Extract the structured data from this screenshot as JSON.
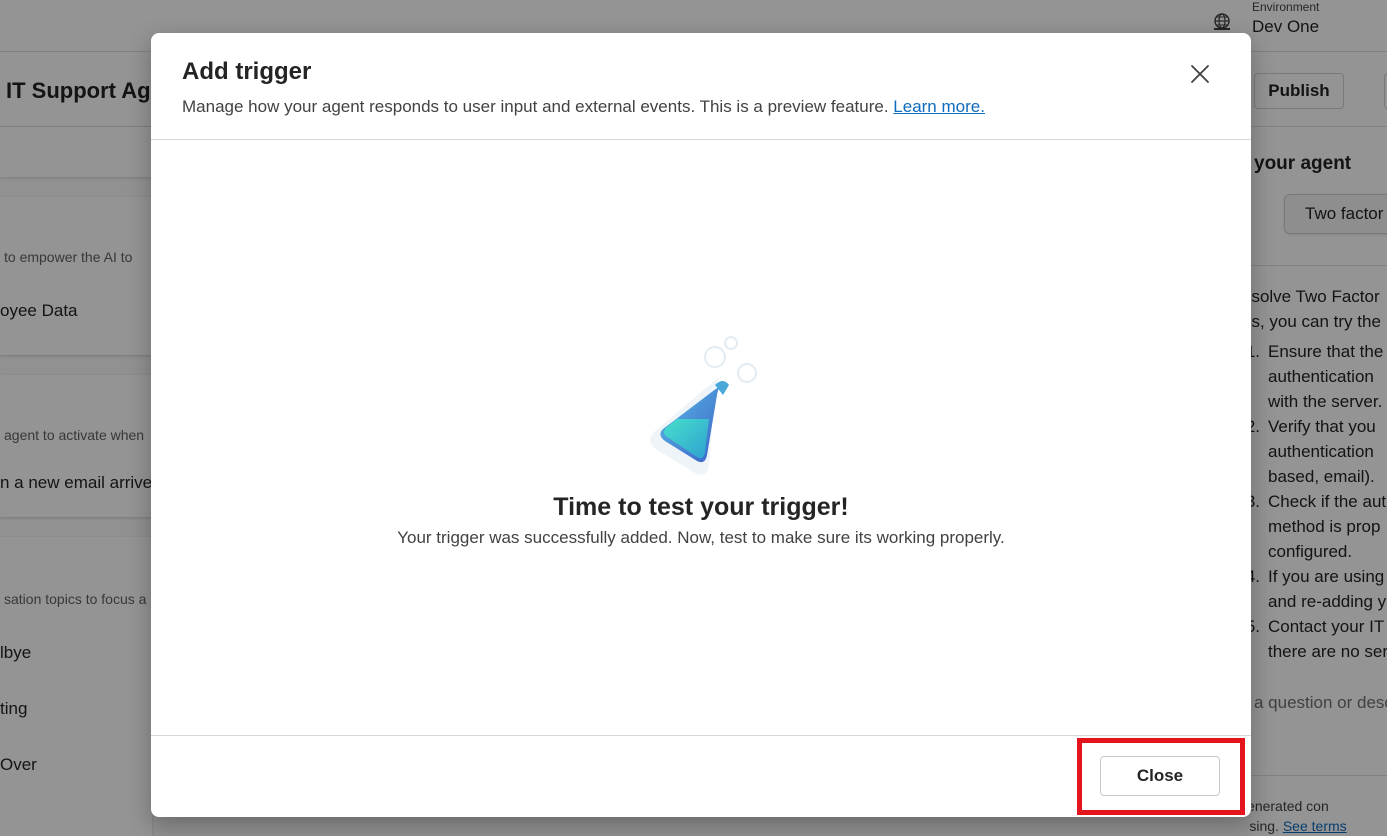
{
  "environment": {
    "label": "Environment",
    "value": "Dev One",
    "icon": "globe-icon"
  },
  "agent": {
    "title": "IT Support Agent"
  },
  "header": {
    "publish_label": "Publish"
  },
  "left_panel": {
    "knowledge": {
      "hint": "to empower the AI to",
      "item": "oyee Data"
    },
    "triggers": {
      "hint": "agent to activate when",
      "item": "n a new email arrives"
    },
    "topics": {
      "hint": "sation topics to focus a",
      "items": [
        "lbye",
        "ting",
        "Over"
      ]
    }
  },
  "test_panel": {
    "title": "your agent",
    "suggestion": "Two factor",
    "reply_intro": [
      "esolve Two Factor",
      "es, you can try the"
    ],
    "steps": [
      {
        "num": "1.",
        "lines": [
          "Ensure that the",
          "authentication",
          "with the server."
        ]
      },
      {
        "num": "2.",
        "lines": [
          "Verify that you",
          "authentication",
          "based, email)."
        ]
      },
      {
        "num": "3.",
        "lines": [
          "Check if the aut",
          "method is prop",
          "configured."
        ]
      },
      {
        "num": "4.",
        "lines": [
          "If you are using",
          "and re-adding y"
        ]
      },
      {
        "num": "5.",
        "lines": [
          "Contact your IT",
          "there are no ser"
        ]
      }
    ],
    "input_placeholder": "a question or desc",
    "disclaimer_line1": "ure AI-generated con",
    "disclaimer_line2": "before using.",
    "see_terms": "See terms"
  },
  "dialog": {
    "title": "Add trigger",
    "subtitle": "Manage how your agent responds to user input and external events. This is a preview feature.",
    "learn_more": "Learn more.",
    "empty_state_title": "Time to test your trigger!",
    "empty_state_desc": "Your trigger was successfully added. Now, test to make sure its working properly.",
    "close_label": "Close",
    "illustration": "flask-icon",
    "close_icon": "close-icon"
  },
  "colors": {
    "accent_link": "#0f6cbd",
    "highlight": "#e3141c",
    "flask_top": "#4aa8d8",
    "flask_liquid": "#3fd6c9",
    "flask_dark": "#3a5fc8"
  }
}
